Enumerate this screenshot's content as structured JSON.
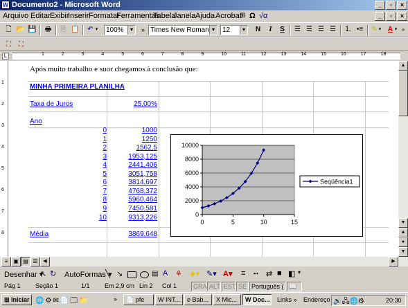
{
  "window": {
    "title": "Documento2 - Microsoft Word",
    "app_icon": "W"
  },
  "menubar": {
    "items": [
      "Arquivo",
      "Editar",
      "Exibir",
      "Inserir",
      "Formatar",
      "Ferramentas",
      "Tabela",
      "Janela",
      "Ajuda",
      "Acrobat"
    ]
  },
  "toolbar": {
    "zoom": "100%",
    "font_name": "Times New Roman",
    "font_size": "12",
    "bold": "N",
    "italic": "I",
    "underline": "S"
  },
  "ruler": {
    "numbers": [
      "1",
      "2",
      "3",
      "4",
      "5",
      "6",
      "7",
      "8",
      "9",
      "10",
      "11",
      "12",
      "13",
      "14",
      "15",
      "16",
      "17",
      "18"
    ]
  },
  "document": {
    "intro": "Após muito trabalho e suor chegamos à conclusão que:",
    "heading": "MINHA PRIMEIRA PLANILHA",
    "rate_label": "Taxa de Juros",
    "rate_value": "25,00%",
    "year_label": "Ano",
    "rows": [
      {
        "year": "0",
        "value": "1000"
      },
      {
        "year": "1",
        "value": "1250"
      },
      {
        "year": "2",
        "value": "1562,5"
      },
      {
        "year": "3",
        "value": "1953,125"
      },
      {
        "year": "4",
        "value": "2441,406"
      },
      {
        "year": "5",
        "value": "3051,758"
      },
      {
        "year": "6",
        "value": "3814,697"
      },
      {
        "year": "7",
        "value": "4768,372"
      },
      {
        "year": "8",
        "value": "5960,464"
      },
      {
        "year": "9",
        "value": "7450,581"
      },
      {
        "year": "10",
        "value": "9313,226"
      }
    ],
    "avg_label": "Média",
    "avg_value": "3869,648"
  },
  "chart_data": {
    "type": "line",
    "x": [
      0,
      1,
      2,
      3,
      4,
      5,
      6,
      7,
      8,
      9,
      10
    ],
    "series": [
      {
        "name": "Seqüência1",
        "values": [
          1000,
          1250,
          1562.5,
          1953.125,
          2441.406,
          3051.758,
          3814.697,
          4768.372,
          5960.464,
          7450.581,
          9313.226
        ]
      }
    ],
    "xlim": [
      0,
      15
    ],
    "ylim": [
      0,
      10000
    ],
    "xticks": [
      "0",
      "5",
      "10",
      "15"
    ],
    "yticks": [
      "0",
      "2000",
      "4000",
      "6000",
      "8000",
      "10000"
    ],
    "legend": "right",
    "plot_bg": "#c0c0c0",
    "line_color": "#000080",
    "grid": true
  },
  "drawbar": {
    "draw_label": "Desenhar",
    "autoshapes_label": "AutoFormas"
  },
  "status": {
    "page": "Pág 1",
    "section": "Seção 1",
    "pages": "1/1",
    "at": "Em 2,9 cm",
    "line": "Lin 2",
    "col": "Col 1",
    "rec": "GRA",
    "trk": "ALT",
    "ext": "EST",
    "ovr": "SE",
    "language": "Português ("
  },
  "taskbar": {
    "start": "Iniciar",
    "tasks": [
      "pfe",
      "INT...",
      "Bab...",
      "Mic...",
      "Doc..."
    ],
    "links": "Links",
    "address": "Endereço",
    "clock": "20:30"
  }
}
